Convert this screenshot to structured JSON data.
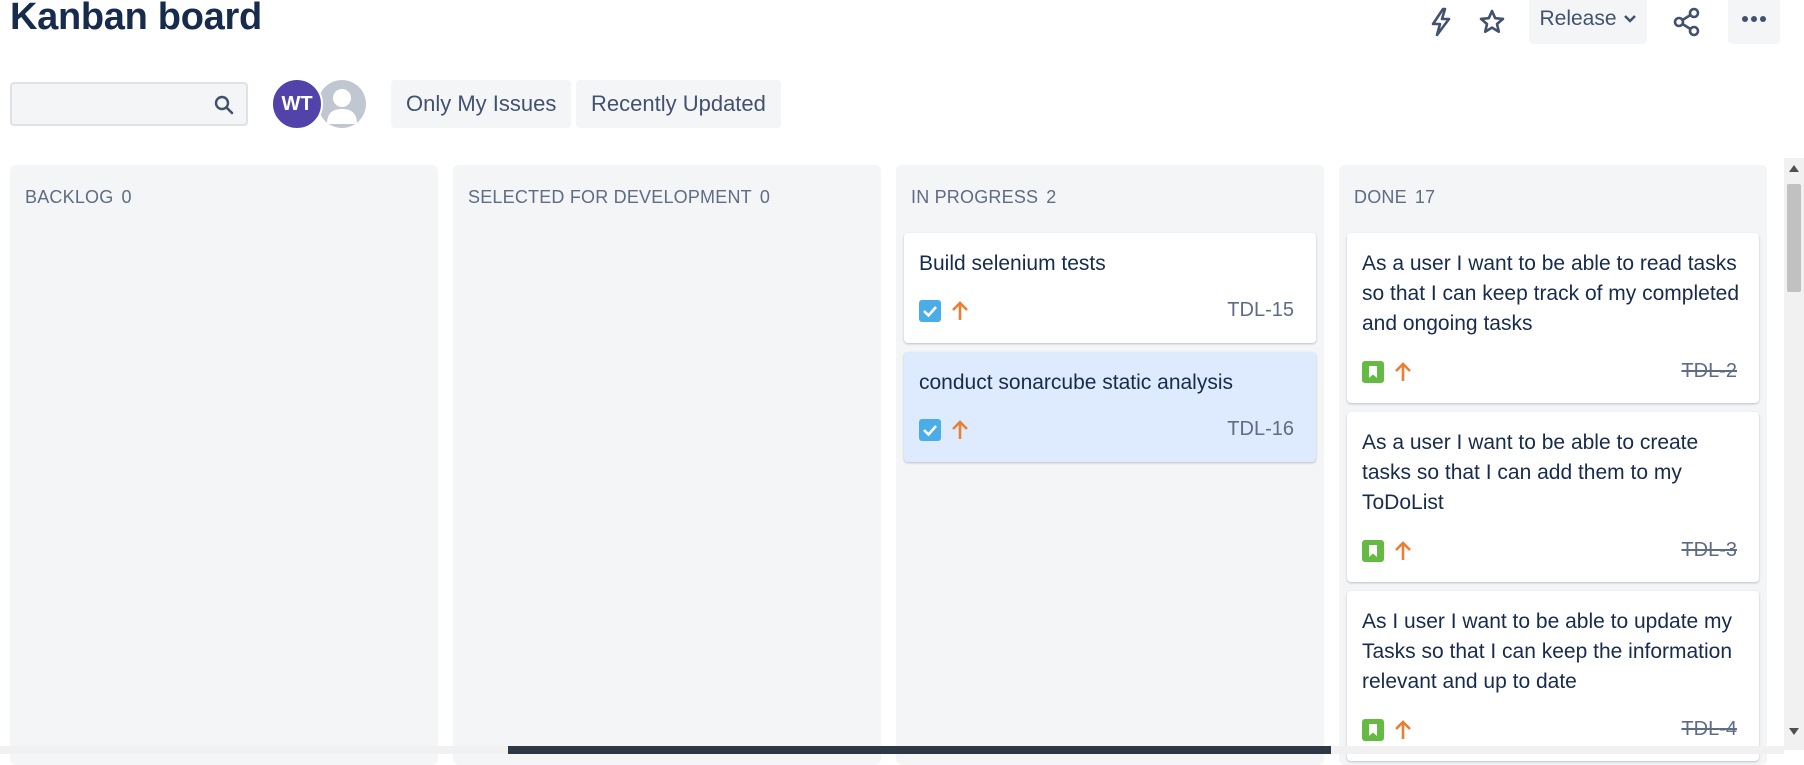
{
  "header": {
    "title": "Kanban board",
    "release_label": "Release"
  },
  "toolbar": {
    "search_placeholder": "",
    "filters": [
      "Only My Issues",
      "Recently Updated"
    ],
    "avatars": [
      {
        "initials": "WT",
        "color": "#5243aa"
      },
      {
        "initials": "",
        "color": "#c1c7d0"
      }
    ]
  },
  "columns": [
    {
      "name": "BACKLOG",
      "count": "0",
      "cards": []
    },
    {
      "name": "SELECTED FOR DEVELOPMENT",
      "count": "0",
      "cards": []
    },
    {
      "name": "IN PROGRESS",
      "count": "2",
      "cards": [
        {
          "summary": "Build selenium tests",
          "key": "TDL-15",
          "type": "task-checkbox-icon",
          "priority": "arrow-up-icon",
          "selected": false
        },
        {
          "summary": "conduct sonarcube static analysis",
          "key": "TDL-16",
          "type": "task-checkbox-icon",
          "priority": "arrow-up-icon",
          "selected": true
        }
      ]
    },
    {
      "name": "DONE",
      "count": "17",
      "cards": [
        {
          "summary": "As a user I want to be able to read tasks so that I can keep track of my completed and ongoing tasks",
          "key": "TDL-2",
          "type": "story-bookmark-icon",
          "priority": "arrow-up-icon",
          "done": true
        },
        {
          "summary": "As a user I want to be able to create tasks so that I can add them to my ToDoList",
          "key": "TDL-3",
          "type": "story-bookmark-icon",
          "priority": "arrow-up-icon",
          "done": true
        },
        {
          "summary": "As I user I want to be able to update my Tasks so that I can keep the information relevant and up to date",
          "key": "TDL-4",
          "type": "story-bookmark-icon",
          "priority": "arrow-up-icon",
          "done": true
        }
      ]
    }
  ],
  "colors": {
    "accent_avatar": "#5243aa",
    "task_icon": "#4bade8",
    "story_icon": "#65ba43",
    "priority_high": "#e97f33",
    "selected_card": "#deebff"
  }
}
